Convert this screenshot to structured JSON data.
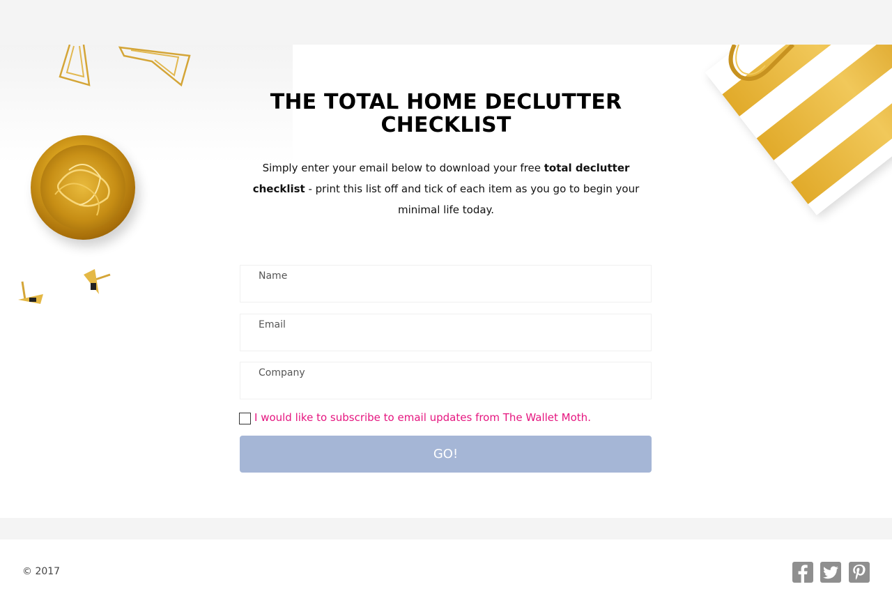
{
  "hero": {
    "title": "THE TOTAL HOME DECLUTTER CHECKLIST",
    "intro_before": "Simply enter your email below to download your free ",
    "intro_bold": "total declutter checklist",
    "intro_after": " - print this list off and tick of each item as you go to begin your minimal life today."
  },
  "form": {
    "name_label": "Name",
    "name_value": "",
    "email_label": "Email",
    "email_value": "",
    "company_label": "Company",
    "company_value": "",
    "subscribe_label": "I would like to subscribe to email updates from The Wallet Moth.",
    "subscribe_checked": false,
    "submit_label": "GO!"
  },
  "footer": {
    "copyright": "© 2017",
    "social": [
      "facebook-icon",
      "twitter-icon",
      "pinterest-icon"
    ]
  },
  "colors": {
    "accent_pink": "#e5157f",
    "button": "#a5b6d6",
    "band_gray": "#f4f4f4",
    "gold": "#d9a21e",
    "social_gray": "#8f8f8f"
  }
}
